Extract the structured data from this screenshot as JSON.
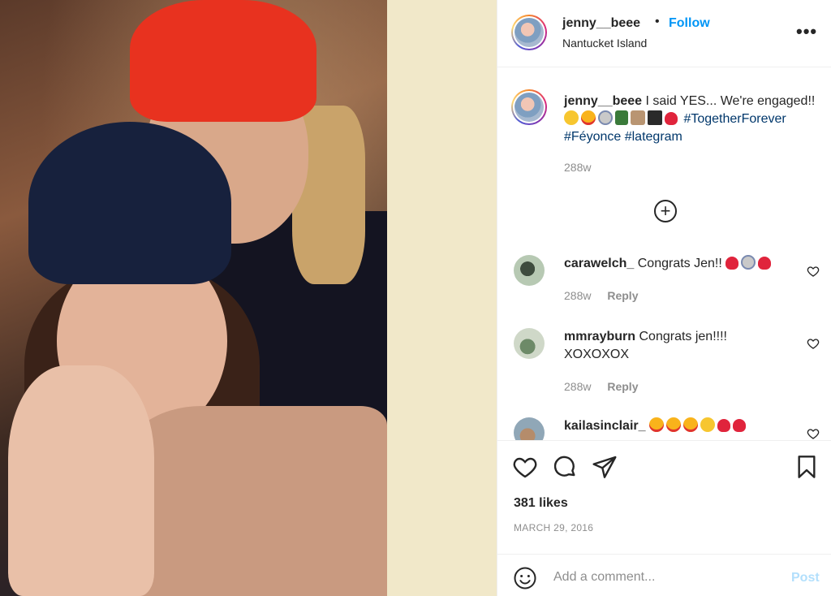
{
  "post": {
    "username": "jenny__beee",
    "follow_label": "Follow",
    "separator": "•",
    "location": "Nantucket Island",
    "more_label": "•••"
  },
  "caption": {
    "username": "jenny__beee",
    "text": "I said YES... We're engaged!!",
    "emojis": [
      "smiling-face",
      "heart-eyes",
      "ring",
      "champagne",
      "bride",
      "top-hat",
      "red-heart"
    ],
    "hashtags": [
      "#TogetherForever",
      "#Féyonce",
      "#lategram"
    ],
    "time": "288w"
  },
  "load_more_label": "+",
  "comments": [
    {
      "username": "carawelch_",
      "text": "Congrats Jen!!",
      "emojis": [
        "red-heart",
        "ring",
        "red-heart"
      ],
      "time": "288w",
      "reply_label": "Reply"
    },
    {
      "username": "mmrayburn",
      "text": "Congrats jen!!!! XOXOXOX",
      "emojis": [],
      "time": "288w",
      "reply_label": "Reply"
    },
    {
      "username": "kailasinclair_",
      "text": "",
      "emojis": [
        "heart-eyes",
        "heart-eyes",
        "heart-eyes",
        "face-blowing-kiss",
        "red-heart",
        "sparkling-heart"
      ],
      "time": "",
      "reply_label": ""
    }
  ],
  "actions": {
    "likes": "381 likes",
    "date": "MARCH 29, 2016"
  },
  "add_comment": {
    "placeholder": "Add a comment...",
    "post_label": "Post"
  },
  "colors": {
    "link_blue": "#0095f6",
    "hashtag_blue": "#00376b",
    "post_disabled": "#b2dffc",
    "muted": "#8e8e8e",
    "gap_cream": "#f1e8c9"
  }
}
